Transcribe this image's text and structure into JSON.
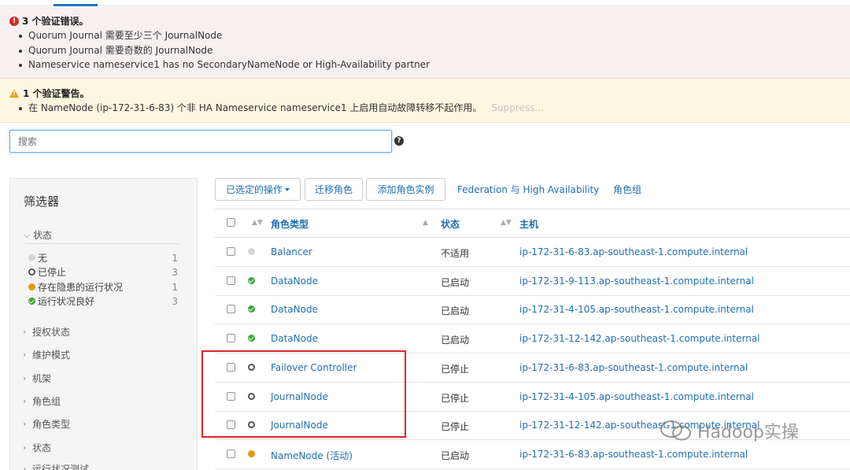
{
  "errors": {
    "title": "3 个验证错误。",
    "items": [
      "Quorum Journal 需要至少三个 JournalNode",
      "Quorum Journal 需要奇数的 JournalNode",
      "Nameservice nameservice1 has no SecondaryNameNode or High-Availability partner"
    ]
  },
  "warnings": {
    "title": "1 个验证警告。",
    "items": [
      "在 NameNode (ip-172-31-6-83) 个非 HA Nameservice nameservice1 上启用自动故障转移不起作用。"
    ],
    "suppress_label": "Suppress..."
  },
  "search": {
    "placeholder": "搜索",
    "help_icon": "question-circle-icon"
  },
  "filter": {
    "title": "筛选器",
    "status_section": "状态",
    "status_items": [
      {
        "label": "无",
        "count": "1",
        "icon": "gray-dot-icon"
      },
      {
        "label": "已停止",
        "count": "3",
        "icon": "stopped-circle-icon"
      },
      {
        "label": "存在隐患的运行状况",
        "count": "1",
        "icon": "orange-dot-icon"
      },
      {
        "label": "运行状况良好",
        "count": "3",
        "icon": "green-check-icon"
      }
    ],
    "sections": [
      "授权状态",
      "维护模式",
      "机架",
      "角色组",
      "角色类型",
      "状态",
      "运行状况测试"
    ]
  },
  "toolbar": {
    "actions_label": "已选定的操作",
    "migrate_label": "迁移角色",
    "add_instances_label": "添加角色实例",
    "federation_label": "Federation 与 High Availability",
    "role_groups_label": "角色组"
  },
  "table": {
    "headers": {
      "role_type": "角色类型",
      "state": "状态",
      "host": "主机"
    },
    "rows": [
      {
        "role": "Balancer",
        "state": "不适用",
        "host": "ip-172-31-6-83.ap-southeast-1.compute.internal",
        "status": "none"
      },
      {
        "role": "DataNode",
        "state": "已启动",
        "host": "ip-172-31-9-113.ap-southeast-1.compute.internal",
        "status": "good"
      },
      {
        "role": "DataNode",
        "state": "已启动",
        "host": "ip-172-31-4-105.ap-southeast-1.compute.internal",
        "status": "good"
      },
      {
        "role": "DataNode",
        "state": "已启动",
        "host": "ip-172-31-12-142.ap-southeast-1.compute.internal",
        "status": "good"
      },
      {
        "role": "Failover Controller",
        "state": "已停止",
        "host": "ip-172-31-6-83.ap-southeast-1.compute.internal",
        "status": "stopped"
      },
      {
        "role": "JournalNode",
        "state": "已停止",
        "host": "ip-172-31-4-105.ap-southeast-1.compute.internal",
        "status": "stopped"
      },
      {
        "role": "JournalNode",
        "state": "已停止",
        "host": "ip-172-31-12-142.ap-southeast-1.compute.internal",
        "status": "stopped"
      },
      {
        "role": "NameNode (活动)",
        "state": "已启动",
        "host": "ip-172-31-6-83.ap-southeast-1.compute.internal",
        "status": "concerning"
      }
    ]
  },
  "watermark": {
    "text": "Hadoop实操"
  },
  "colors": {
    "link": "#1f6fb2",
    "error": "#c9302c",
    "warning": "#e8a21b",
    "good": "#3da53d",
    "concerning": "#e8960c",
    "highlight": "#e0252a"
  }
}
